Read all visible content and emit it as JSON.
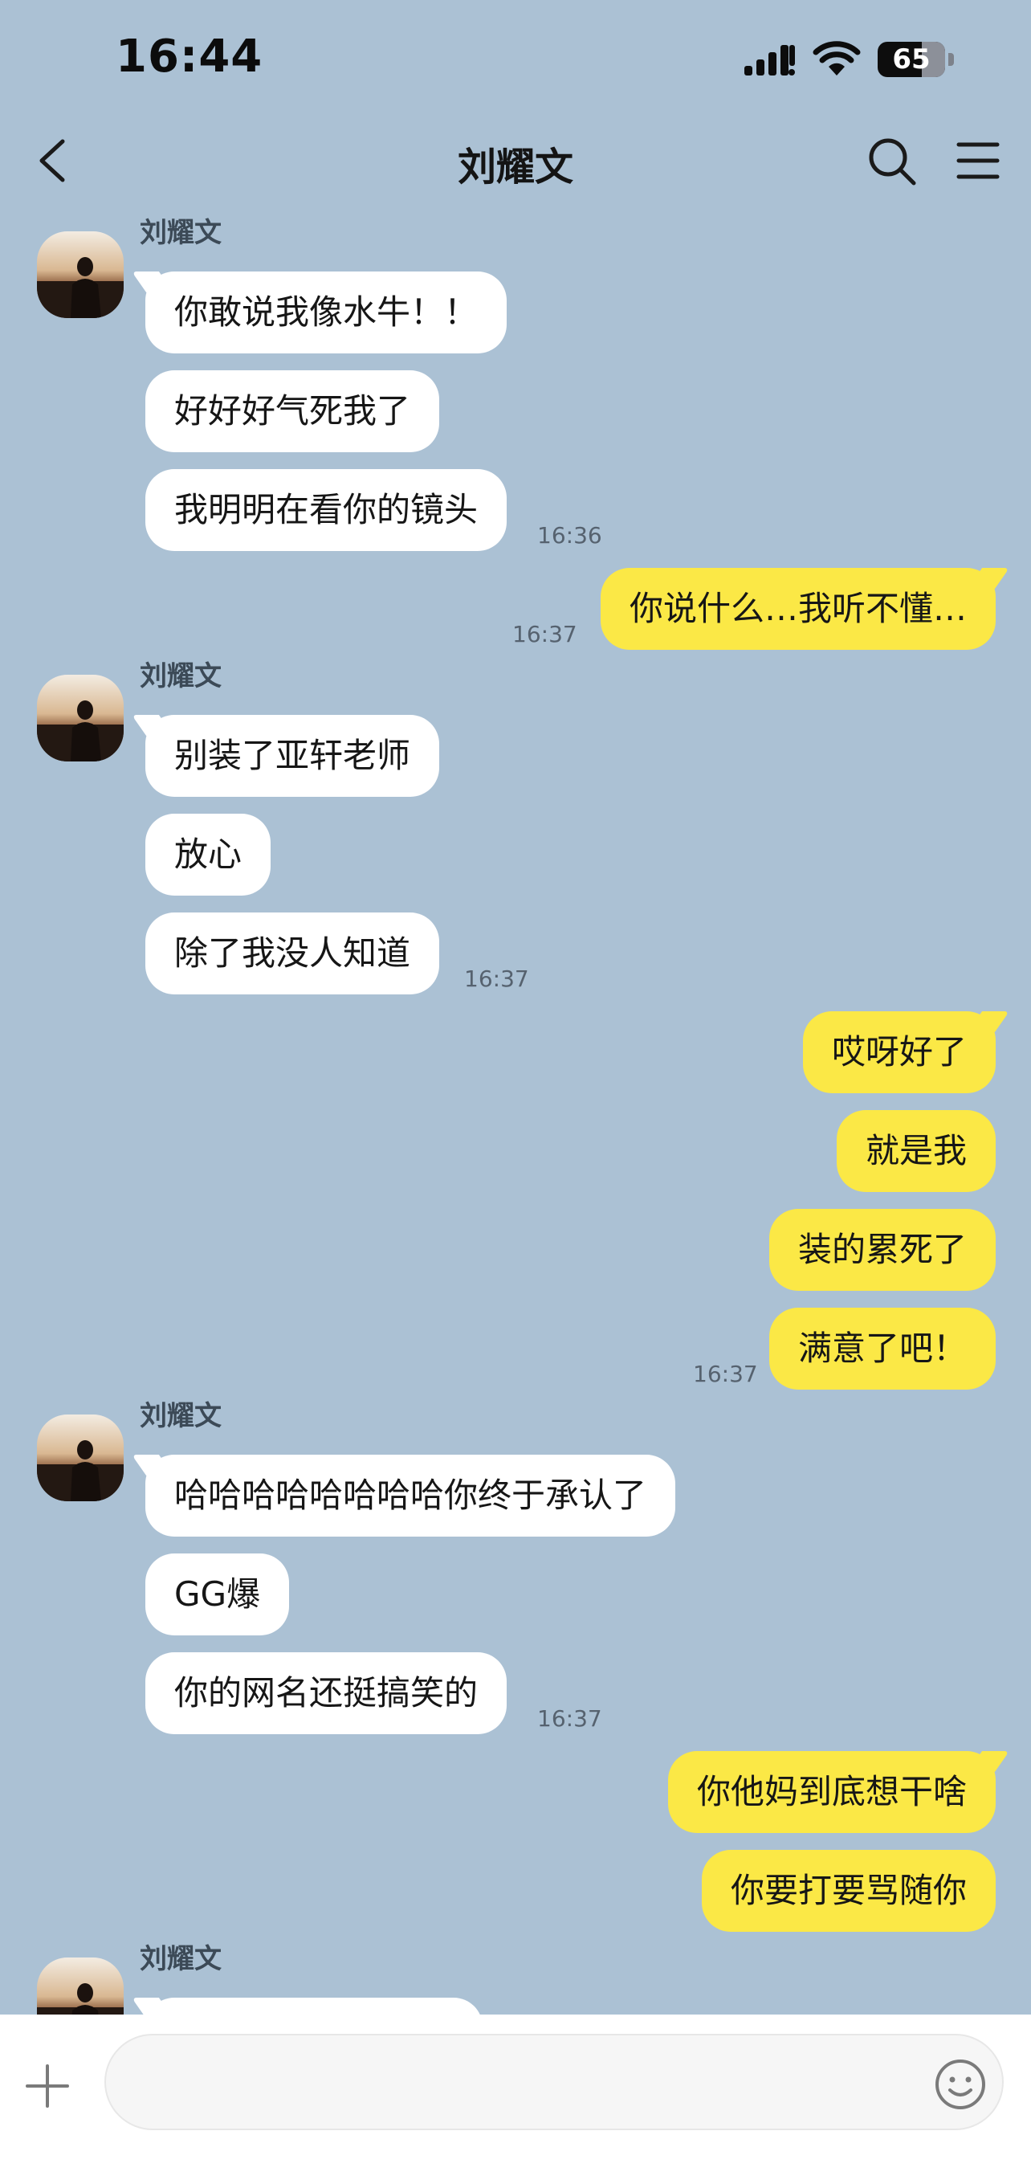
{
  "status_bar": {
    "time": "16:44",
    "battery_percent": 65,
    "icons": [
      "signal-icon",
      "wifi-icon",
      "battery-icon"
    ]
  },
  "nav": {
    "title": "刘耀文",
    "icons": [
      "back-icon",
      "search-icon",
      "menu-icon"
    ]
  },
  "colors": {
    "background": "#abc1d4",
    "incoming_bubble": "#ffffff",
    "outgoing_bubble": "#fbe846",
    "input_bar": "#ffffff"
  },
  "messages": [
    {
      "sender": "刘耀文",
      "text": "你敢说我像水牛！！"
    },
    {
      "sender": "刘耀文",
      "text": "好好好气死我了"
    },
    {
      "sender": "刘耀文",
      "text": "我明明在看你的镜头",
      "time": "16:36"
    },
    {
      "sender": "me",
      "text": "你说什么…我听不懂…",
      "time": "16:37"
    },
    {
      "sender": "刘耀文",
      "text": "别装了亚轩老师"
    },
    {
      "sender": "刘耀文",
      "text": "放心"
    },
    {
      "sender": "刘耀文",
      "text": "除了我没人知道",
      "time": "16:37"
    },
    {
      "sender": "me",
      "text": "哎呀好了"
    },
    {
      "sender": "me",
      "text": "就是我"
    },
    {
      "sender": "me",
      "text": "装的累死了"
    },
    {
      "sender": "me",
      "text": "满意了吧！",
      "time": "16:37"
    },
    {
      "sender": "刘耀文",
      "text": "哈哈哈哈哈哈哈哈你终于承认了"
    },
    {
      "sender": "刘耀文",
      "text": "GG爆"
    },
    {
      "sender": "刘耀文",
      "text": "你的网名还挺搞笑的",
      "time": "16:37"
    },
    {
      "sender": "me",
      "text": "你他妈到底想干啥"
    },
    {
      "sender": "me",
      "text": "你要打要骂随你"
    },
    {
      "sender": "刘耀文",
      "text": ""
    }
  ],
  "input_bar": {
    "placeholder": "",
    "value": "",
    "icons": [
      "add-icon",
      "emoji-icon"
    ]
  }
}
